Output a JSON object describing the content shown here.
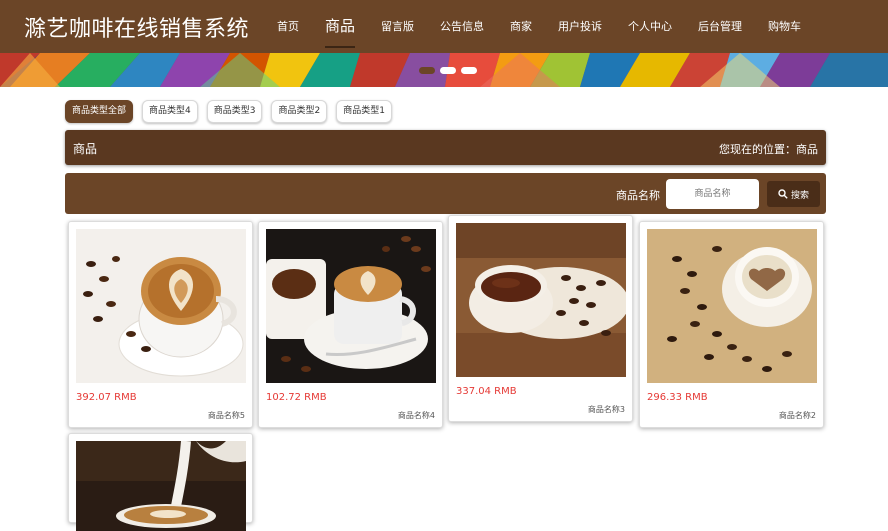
{
  "header": {
    "title": "滁艺咖啡在线销售系统",
    "nav": [
      "首页",
      "商品",
      "留言版",
      "公告信息",
      "商家",
      "用户投诉",
      "个人中心",
      "后台管理",
      "购物车"
    ],
    "active_nav": "商品"
  },
  "filters": {
    "items": [
      "商品类型全部",
      "商品类型4",
      "商品类型3",
      "商品类型2",
      "商品类型1"
    ],
    "active": "商品类型全部"
  },
  "titlebar": {
    "section": "商品",
    "location": "您现在的位置：商品"
  },
  "search": {
    "label": "商品名称",
    "placeholder": "商品名称",
    "button": "搜索"
  },
  "products": [
    {
      "price": "392.07 RMB",
      "name": "商品名称5"
    },
    {
      "price": "102.72 RMB",
      "name": "商品名称4"
    },
    {
      "price": "337.04 RMB",
      "name": "商品名称3"
    },
    {
      "price": "296.33 RMB",
      "name": "商品名称2"
    }
  ],
  "colors": {
    "brand": "#6b4527",
    "price": "#e53935"
  }
}
